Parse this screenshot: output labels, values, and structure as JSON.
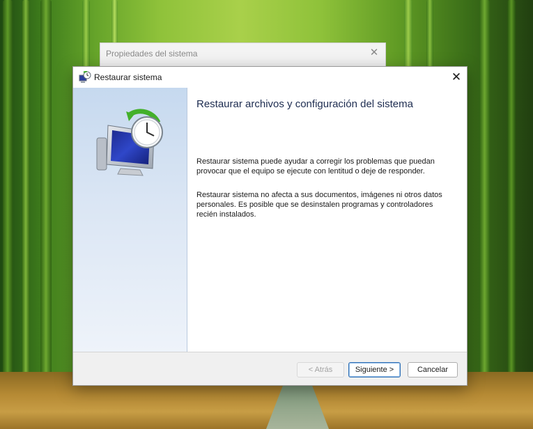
{
  "background_window": {
    "title": "Propiedades del sistema",
    "close_glyph": "✕"
  },
  "dialog": {
    "title": "Restaurar sistema",
    "close_glyph": "✕",
    "heading": "Restaurar archivos y configuración del sistema",
    "paragraph_1": "Restaurar sistema puede ayudar a corregir los problemas que puedan provocar que el equipo se ejecute con lentitud o deje de responder.",
    "paragraph_2": "Restaurar sistema no afecta a sus documentos, imágenes ni otros datos personales. Es posible que se desinstalen programas y controladores recién instalados.",
    "icons": {
      "title": "system-restore-icon",
      "hero": "system-restore-computer-icon"
    }
  },
  "buttons": {
    "back": "< Atrás",
    "back_enabled": false,
    "next": "Siguiente >",
    "cancel": "Cancelar"
  },
  "colors": {
    "heading": "#1d2c50",
    "sidebar_top": "#c6d9ef",
    "default_button_border": "#2f6fb5"
  }
}
